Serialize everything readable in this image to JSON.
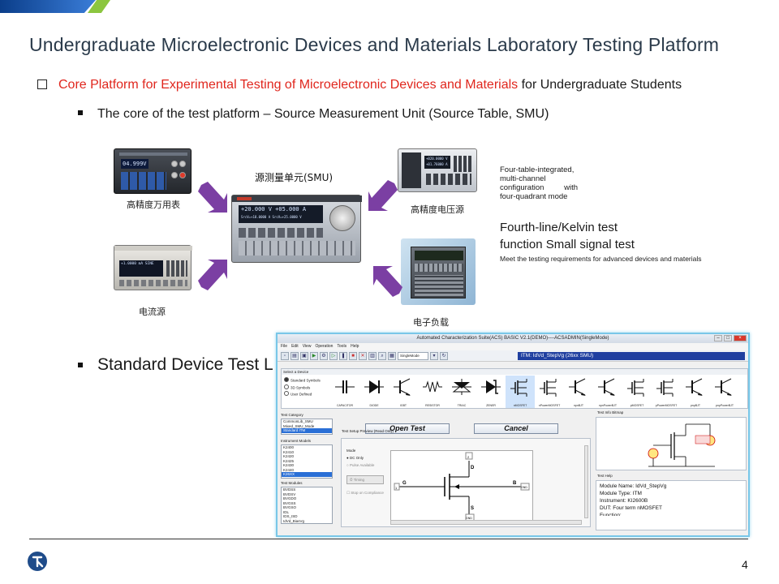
{
  "slide": {
    "title": "Undergraduate Microelectronic Devices and Materials Laboratory Testing Platform",
    "bullet1_red": "Core Platform for Experimental Testing of Microelectronic Devices and Materials",
    "bullet1_black": " for Undergraduate Students",
    "bullet2": "The core of the test platform – Source Measurement Unit (Source Table, SMU)",
    "bullet3": "Standard Device Test L",
    "page_number": "4"
  },
  "instruments": {
    "smu_label": "源测量单元(SMU)",
    "dmm": "高精度万用表",
    "voltage_source": "高精度电压源",
    "current_source": "电流源",
    "electronic_load": "电子负载",
    "dmm_display": "04.999V",
    "smu_display_1": "+20.000 V   +05.000 A",
    "smu_display_2": "SrcV=+18.0000 A  SrcV=+25.0000 V",
    "vsrc_display_1": "+020.0000 V",
    "vsrc_display_2": "+01.76000 A",
    "isrc_display": "+1.0000 mA    SINE"
  },
  "descriptions": {
    "d1": "Four-table-integrated, multi-channel configuration with four-quadrant mode",
    "d2": "Fourth-line/Kelvin test function Small signal test",
    "d3": "Meet the testing requirements for advanced devices and materials"
  },
  "software": {
    "window_title": "Automated Characterization Suite(ACS) BASIC V2.1(DEMO)----ACSADMIN(SingleMode)",
    "menu": [
      "File",
      "Edit",
      "View",
      "Operation",
      "Tools",
      "Help"
    ],
    "mode_combo": "SingleMode",
    "itm_field": "ITM: IdVd_StepVg (26xx SMU)",
    "select_device": "Select a Device",
    "radio_options": [
      "Standard Symbols",
      "3D Symbols",
      "User Defined"
    ],
    "devices": [
      "CAPACITOR",
      "DIODE",
      "IGBT",
      "RESISTOR",
      "TRIAC",
      "ZENER",
      "nMOSFET",
      "nPowerMOSFET",
      "npnBJT",
      "npnPowerBJT",
      "pMOSFET",
      "pPowerMOSFET",
      "pnpBJT",
      "pnpPowerBJT"
    ],
    "test_category_label": "Test Category",
    "test_categories": [
      "CommonLib_SMU",
      "Mixed_SMU_Mode",
      "Standard ITM"
    ],
    "instrument_models_label": "Instrument Models",
    "instrument_models": [
      "K2400",
      "K2410",
      "K2420",
      "K2425",
      "K2430",
      "K2440",
      "K26XX"
    ],
    "test_modules_label": "Test Modules",
    "test_modules": [
      "BVDSS",
      "BVDSV",
      "BVGDO",
      "BVGSS",
      "BVGSO",
      "IDL",
      "IDS_ISD",
      "IdVd_BiasVg"
    ],
    "open_test": "Open Test",
    "cancel": "Cancel",
    "preview_label": "Test Setup Preview (Read Only)",
    "mode_label": "Mode",
    "mode_opt1": "DC Only",
    "mode_opt2": "Pulse Available",
    "timing": "Timing",
    "stop_on_compliance": "Stop on Compliance",
    "terminals": {
      "g": "G",
      "d": "D",
      "s": "S",
      "b": "B"
    },
    "pins": {
      "p1": "1",
      "p2": "2",
      "p3": "3",
      "gnd1": "GND",
      "gnd2": "GND"
    },
    "test_info_label": "Test Info Bitmap",
    "test_help_label": "Test Help",
    "help_lines": [
      "Module Name: IdVd_StepVg",
      "Module Type: ITM",
      "Instrument: KI2600B",
      "DUT: Four term nMOSFET",
      "Function:"
    ]
  },
  "colors": {
    "title_text": "#2a3a4a",
    "red_text": "#e0261d",
    "arrow_purple": "#7b3fa3",
    "itm_blue": "#1f3fa0",
    "window_border": "#79c7e8"
  }
}
